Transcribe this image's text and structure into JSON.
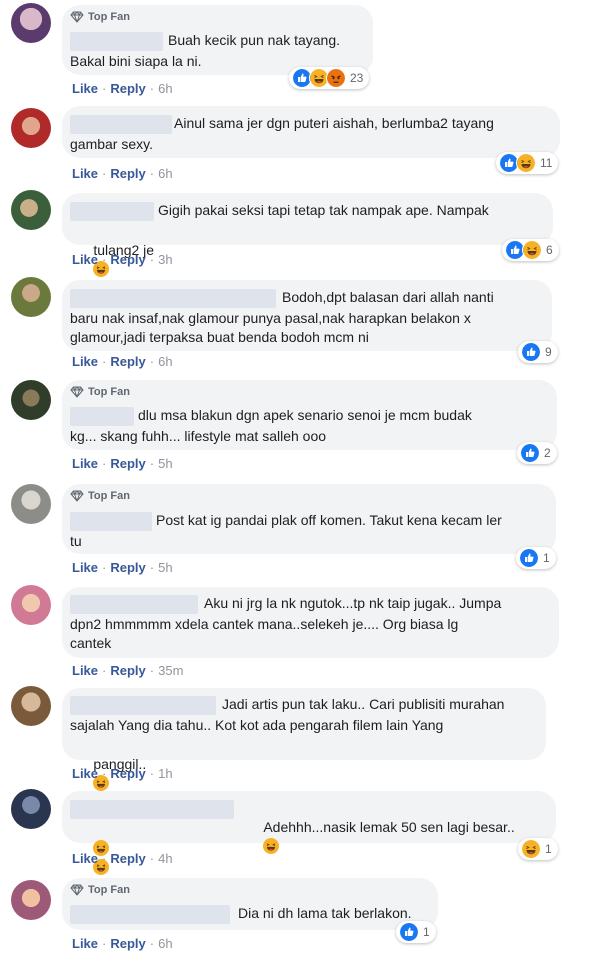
{
  "labels": {
    "like": "Like",
    "reply": "Reply",
    "dot": "·",
    "top_fan": "Top Fan"
  },
  "comments": [
    {
      "top_fan": true,
      "line1": "Buah kecik pun nak tayang.",
      "line2": "Bakal bini siapa la ni.",
      "time": "6h",
      "reactions": [
        "like-icon",
        "haha-icon",
        "angry-icon"
      ],
      "count": "23",
      "avatar": "#5b3b6e"
    },
    {
      "top_fan": false,
      "line1": "Ainul sama jer dgn puteri aishah, berlumba2 tayang",
      "line2": "gambar sexy.",
      "time": "6h",
      "reactions": [
        "like-icon",
        "haha-icon"
      ],
      "count": "11",
      "avatar": "#b02a2a"
    },
    {
      "top_fan": false,
      "line1": "Gigih pakai seksi tapi tetap tak nampak ape. Nampak",
      "line2": "tulang2 je",
      "time": "3h",
      "reactions": [
        "like-icon",
        "haha-icon"
      ],
      "count": "6",
      "avatar": "#3b5f3a"
    },
    {
      "top_fan": false,
      "line1": "Bodoh,dpt balasan dari allah nanti",
      "line2": "baru nak insaf,nak glamour punya pasal,nak harapkan belakon x",
      "line3": "glamour,jadi terpaksa buat benda bodoh mcm ni",
      "time": "6h",
      "reactions": [
        "like-icon"
      ],
      "count": "9",
      "avatar": "#6b7a3c"
    },
    {
      "top_fan": true,
      "line1": "dlu msa blakun dgn apek senario senoi je mcm budak",
      "line2": "kg... skang fuhh... lifestyle mat salleh ooo",
      "time": "5h",
      "reactions": [
        "like-icon"
      ],
      "count": "2",
      "avatar": "#2f3d2a"
    },
    {
      "top_fan": true,
      "line1": "Post kat ig pandai plak off komen. Takut kena kecam ler",
      "line2": "tu",
      "time": "5h",
      "reactions": [
        "like-icon"
      ],
      "count": "1",
      "avatar": "#8c8c88"
    },
    {
      "top_fan": false,
      "line1": "Aku ni jrg la nk ngutok...tp nk taip jugak.. Jumpa",
      "line2": "dpn2 hmmmmm xdela cantek mana..selekeh je.... Org biasa lg",
      "line3": "cantek",
      "time": "35m",
      "reactions": [],
      "count": "",
      "avatar": "#d07a96"
    },
    {
      "top_fan": false,
      "line1": "Jadi artis pun tak laku.. Cari publisiti murahan",
      "line2": "sajalah Yang dia tahu.. Kot kot ada pengarah filem lain Yang",
      "line3": "panggil..",
      "time": "1h",
      "reactions": [],
      "count": "",
      "avatar": "#7a5a3a"
    },
    {
      "top_fan": false,
      "line1": "Adehhh...nasik lemak 50 sen lagi besar..",
      "line2": "",
      "time": "4h",
      "reactions": [
        "haha-icon"
      ],
      "count": "1",
      "avatar": "#2a3550"
    },
    {
      "top_fan": true,
      "line1": "Dia ni dh lama tak berlakon.",
      "line2": "",
      "time": "6h",
      "reactions": [
        "like-icon"
      ],
      "count": "1",
      "avatar": "#9c5a78"
    }
  ],
  "colors": {
    "like": "#1877f2",
    "haha": "#f7b125",
    "angry": "#e9710f",
    "link": "#385898"
  }
}
